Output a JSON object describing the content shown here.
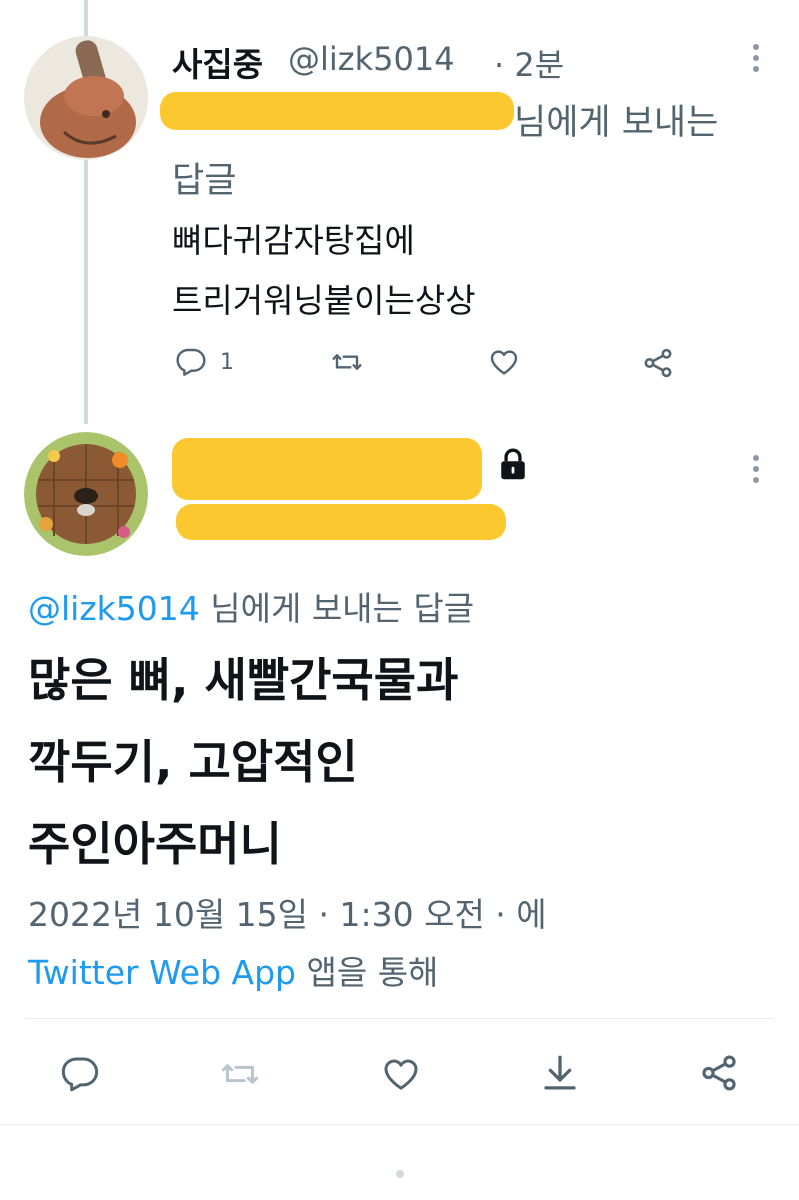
{
  "reply_tweet": {
    "display_name": "사집중",
    "handle": "@lizk5014",
    "time_ago": "· 2분",
    "reply_to_suffix": "님에게 보내는",
    "reply_to_suffix2": "답글",
    "text_line1": "뼈다귀감자탕집에",
    "text_line2": "트리거워닝붙이는상상",
    "reply_count": "1"
  },
  "main_tweet": {
    "reply_to_handle": "@lizk5014",
    "reply_to_suffix": " 님에게 보내는 답글",
    "text_line1": "많은 뼈, 새빨간국물과",
    "text_line2": "깍두기, 고압적인",
    "text_line3": "주인아주머니",
    "timestamp": "2022년 10월 15일 · 1:30 오전 · 에",
    "source_app": "Twitter Web App",
    "source_suffix": " 앱을 통해"
  },
  "icons": {
    "reply": "reply-icon",
    "retweet": "retweet-icon",
    "like": "heart-icon",
    "share": "share-icon",
    "bookmark": "download-icon",
    "lock": "lock-icon",
    "more": "more-icon"
  },
  "colors": {
    "link": "#1d9bf0",
    "muted": "#536471",
    "redaction": "#fcc830"
  }
}
